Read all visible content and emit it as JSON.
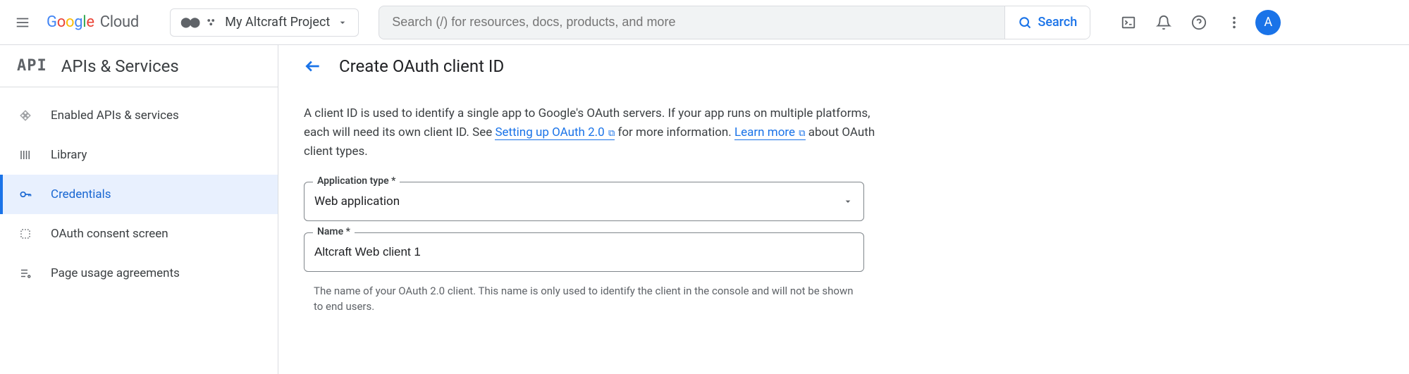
{
  "header": {
    "logo_cloud": "Cloud",
    "project_name": "My Altcraft Project",
    "search_placeholder": "Search (/) for resources, docs, products, and more",
    "search_button": "Search",
    "avatar_letter": "A"
  },
  "sidebar": {
    "title": "APIs & Services",
    "items": [
      {
        "label": "Enabled APIs & services"
      },
      {
        "label": "Library"
      },
      {
        "label": "Credentials"
      },
      {
        "label": "OAuth consent screen"
      },
      {
        "label": "Page usage agreements"
      }
    ]
  },
  "page": {
    "title": "Create OAuth client ID",
    "desc_part1": "A client ID is used to identify a single app to Google's OAuth servers. If your app runs on multiple platforms, each will need its own client ID. See ",
    "desc_link1": "Setting up OAuth 2.0",
    "desc_part2": " for more information. ",
    "desc_link2": "Learn more",
    "desc_part3": " about OAuth client types.",
    "app_type_label": "Application type *",
    "app_type_value": "Web application",
    "name_label": "Name *",
    "name_value": "Altcraft Web client 1",
    "name_helper": "The name of your OAuth 2.0 client. This name is only used to identify the client in the console and will not be shown to end users."
  }
}
